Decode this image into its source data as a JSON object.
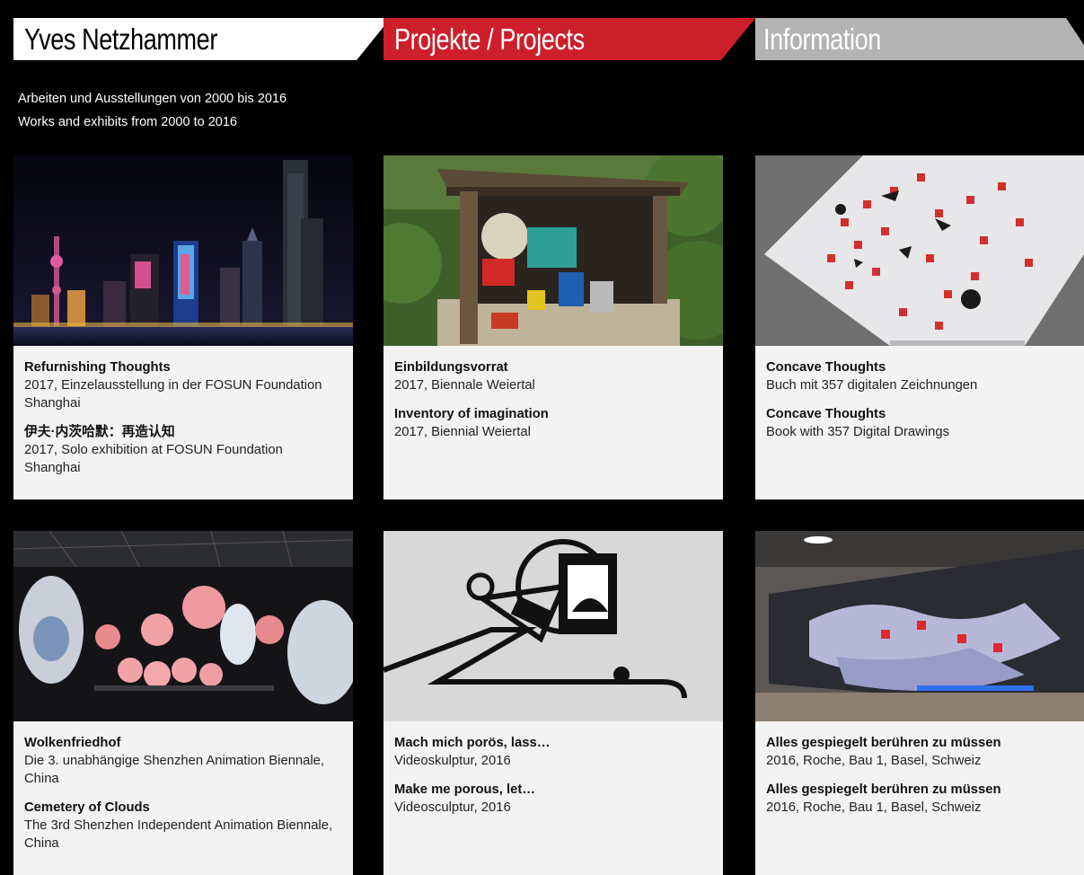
{
  "nav": {
    "home": "Yves Netzhammer",
    "projects": "Projekte / Projects",
    "info": "Information"
  },
  "colors": {
    "home_bg": "#ffffff",
    "projects_bg": "#cc1f2b",
    "info_bg": "#b3b3b3"
  },
  "intro": {
    "de": "Arbeiten und Ausstellungen von 2000 bis 2016",
    "en": "Works and exhibits from 2000 to 2016"
  },
  "cards": [
    {
      "title_1": "Refurnishing Thoughts",
      "desc_1": "2017, Einzelausstellung in der FOSUN Foundation Shanghai",
      "title_2": "伊夫·内茨哈默：再造认知",
      "desc_2": "2017, Solo exhibition at FOSUN Foundation Shanghai"
    },
    {
      "title_1": "Einbildungsvorrat",
      "desc_1": "2017, Biennale Weiertal",
      "title_2": "Inventory of imagination",
      "desc_2": "2017, Biennial Weiertal"
    },
    {
      "title_1": "Concave Thoughts",
      "desc_1": "Buch mit 357 digitalen Zeichnungen",
      "title_2": "Concave Thoughts",
      "desc_2": "Book with 357 Digital Drawings"
    },
    {
      "title_1": "Wolkenfriedhof",
      "desc_1": "Die 3. unabhängige Shenzhen Animation Biennale, China",
      "title_2": "Cemetery of Clouds",
      "desc_2": "The 3rd Shenzhen Independent Animation Biennale, China"
    },
    {
      "title_1": "Mach mich porös, lass…",
      "desc_1": "Videoskulptur, 2016",
      "title_2": "Make me porous, let…",
      "desc_2": "Videosculptur, 2016"
    },
    {
      "title_1": "Alles gespiegelt berühren zu müssen",
      "desc_1": "2016, Roche, Bau 1, Basel, Schweiz",
      "title_2": "Alles gespiegelt berühren zu müssen",
      "desc_2": "2016, Roche, Bau 1, Basel, Schweiz"
    }
  ]
}
